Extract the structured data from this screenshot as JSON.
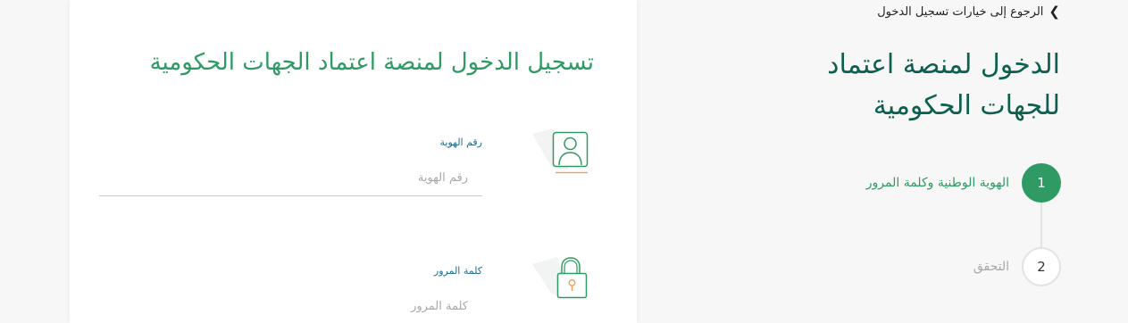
{
  "side": {
    "back_label": "الرجوع إلى خيارات تسجيل الدخول",
    "title": "الدخول لمنصة اعتماد للجهات الحكومية",
    "steps": [
      {
        "number": "1",
        "label": "الهوية الوطنية وكلمة المرور",
        "state": "active"
      },
      {
        "number": "2",
        "label": "التحقق",
        "state": "inactive"
      }
    ]
  },
  "card": {
    "title": "تسجيل الدخول لمنصة اعتماد الجهات الحكومية",
    "user_field": {
      "label": "رقم الهوية",
      "placeholder": "رقم الهوية",
      "value": "",
      "icon": "user-icon"
    },
    "password_field": {
      "label": "كلمة المرور",
      "placeholder": "كلمة المرور",
      "value": "",
      "icon": "lock-icon"
    }
  },
  "colors": {
    "primary_green": "#2f9a63",
    "dark_green": "#0d5f4f",
    "label_blue": "#1f6a8a",
    "icon_underline": "#f0a35a"
  }
}
